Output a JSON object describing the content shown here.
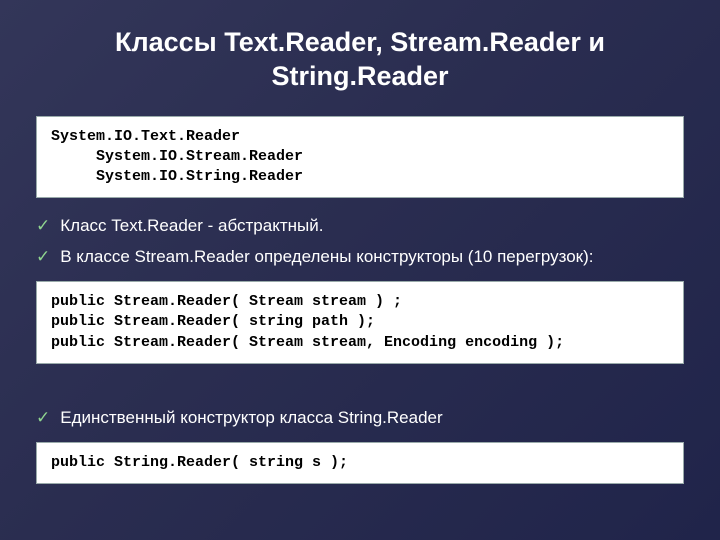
{
  "title": "Классы Text.Reader, Stream.Reader и String.Reader",
  "codebox1": "System.IO.Text.Reader\n     System.IO.Stream.Reader\n     System.IO.String.Reader",
  "bullets": {
    "b1": "Класс Text.Reader  - абстрактный.",
    "b2": "В классе Stream.Reader  определены конструкторы (10 перегрузок):",
    "b3": "Единственный конструктор класса String.Reader"
  },
  "codebox2": "public Stream.Reader( Stream stream ) ;\npublic Stream.Reader( string path );\npublic Stream.Reader( Stream stream, Encoding encoding );",
  "codebox3": "public String.Reader( string s );",
  "checkmark": "✓"
}
